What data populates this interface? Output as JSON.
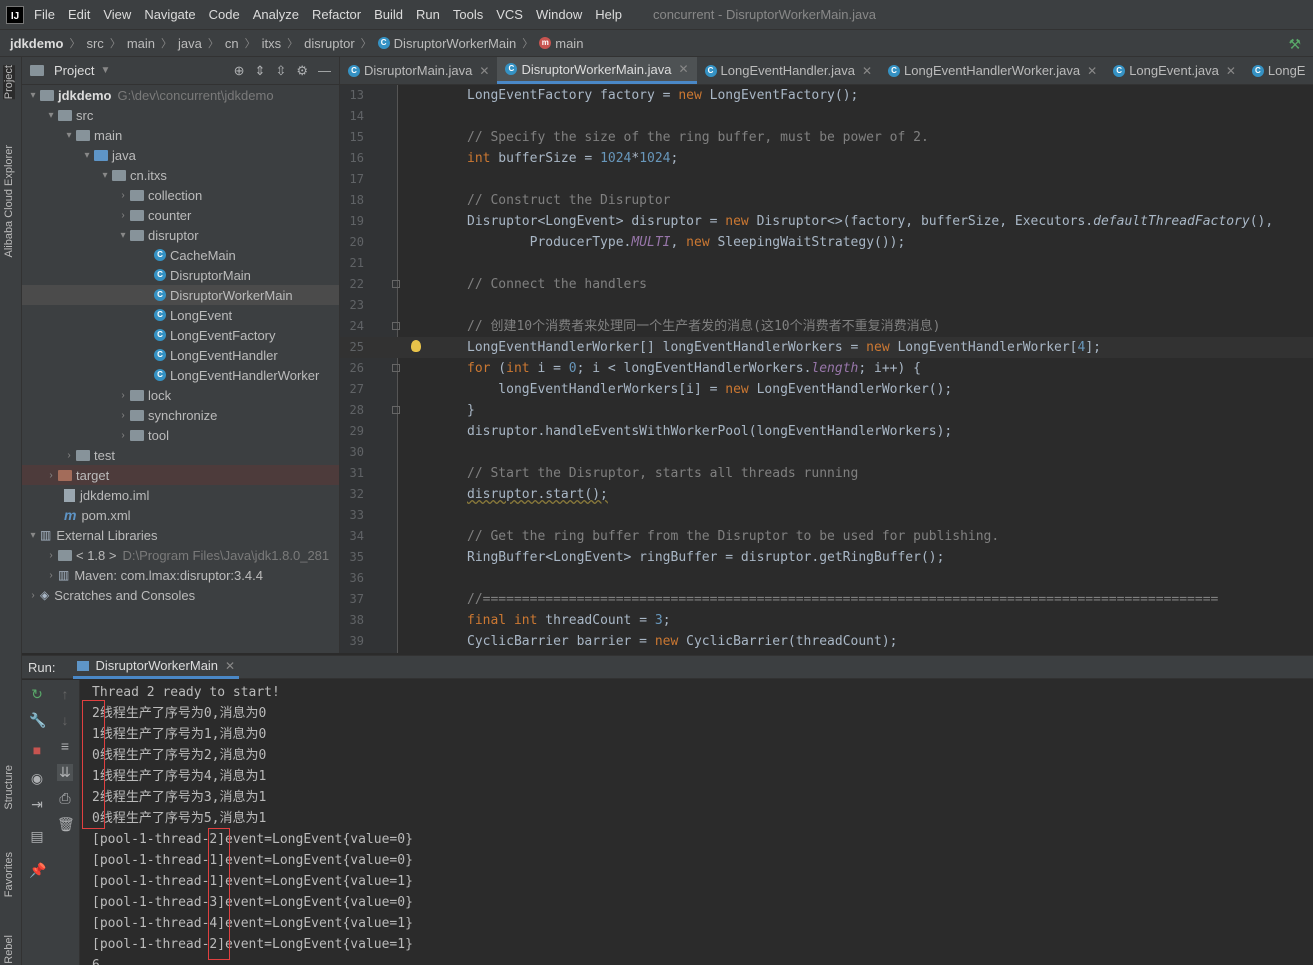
{
  "menubar": {
    "logo": "IJ",
    "items": [
      "File",
      "Edit",
      "View",
      "Navigate",
      "Code",
      "Analyze",
      "Refactor",
      "Build",
      "Run",
      "Tools",
      "VCS",
      "Window",
      "Help"
    ],
    "window_title": "concurrent - DisruptorWorkerMain.java"
  },
  "breadcrumb": {
    "items": [
      "jdkdemo",
      "src",
      "main",
      "java",
      "cn",
      "itxs",
      "disruptor",
      "DisruptorWorkerMain",
      "main"
    ]
  },
  "left_strip": {
    "project": "Project",
    "alibaba": "Alibaba Cloud Explorer",
    "structure": "Structure",
    "favorites": "Favorites",
    "rebel": "Rebel"
  },
  "project_panel": {
    "title": "Project",
    "tree": [
      {
        "label": "jdkdemo",
        "extra": "G:\\dev\\concurrent\\jdkdemo"
      },
      {
        "label": "src"
      },
      {
        "label": "main"
      },
      {
        "label": "java"
      },
      {
        "label": "cn.itxs"
      },
      {
        "label": "collection"
      },
      {
        "label": "counter"
      },
      {
        "label": "disruptor"
      },
      {
        "label": "CacheMain"
      },
      {
        "label": "DisruptorMain"
      },
      {
        "label": "DisruptorWorkerMain"
      },
      {
        "label": "LongEvent"
      },
      {
        "label": "LongEventFactory"
      },
      {
        "label": "LongEventHandler"
      },
      {
        "label": "LongEventHandlerWorker"
      },
      {
        "label": "lock"
      },
      {
        "label": "synchronize"
      },
      {
        "label": "tool"
      },
      {
        "label": "test"
      },
      {
        "label": "target"
      },
      {
        "label": "jdkdemo.iml"
      },
      {
        "label": "pom.xml"
      },
      {
        "label": "External Libraries"
      },
      {
        "label": "< 1.8 >",
        "extra": "D:\\Program Files\\Java\\jdk1.8.0_281"
      },
      {
        "label": "Maven: com.lmax:disruptor:3.4.4"
      },
      {
        "label": "Scratches and Consoles"
      }
    ]
  },
  "editor_tabs": [
    "DisruptorMain.java",
    "DisruptorWorkerMain.java",
    "LongEventHandler.java",
    "LongEventHandlerWorker.java",
    "LongEvent.java",
    "LongE"
  ],
  "editor": {
    "line_numbers": [
      "13",
      "14",
      "15",
      "16",
      "17",
      "18",
      "19",
      "20",
      "21",
      "22",
      "23",
      "24",
      "25",
      "26",
      "27",
      "28",
      "29",
      "30",
      "31",
      "32",
      "33",
      "34",
      "35",
      "36",
      "37",
      "38",
      "39"
    ],
    "lines": {
      "l13": "LongEventFactory factory = ",
      "l13b": "new",
      "l13c": " LongEventFactory();",
      "l15": "// Specify the size of the ring buffer, must be power of 2.",
      "l16a": "int",
      "l16b": " bufferSize = ",
      "l16c": "1024",
      "l16d": "*",
      "l16e": "1024",
      "l16f": ";",
      "l18": "// Construct the Disruptor",
      "l19a": "Disruptor<LongEvent> disruptor = ",
      "l19b": "new",
      "l19c": " Disruptor<>(factory, bufferSize, Executors.",
      "l19d": "defaultThreadFactory",
      "l19e": "(),",
      "l20a": "        ProducerType.",
      "l20b": "MULTI",
      "l20c": ", ",
      "l20d": "new",
      "l20e": " SleepingWaitStrategy());",
      "l22": "// Connect the handlers",
      "l24": "// 创建10个消费者来处理同一个生产者发的消息(这10个消费者不重复消费消息)",
      "l25a": "LongEventHandlerWorker[] longEventHandlerWorkers = ",
      "l25b": "new",
      "l25c": " LongEventHandlerWorker[",
      "l25d": "4",
      "l25e": "];",
      "l26a": "for",
      "l26b": " (",
      "l26c": "int",
      "l26d": " i = ",
      "l26e": "0",
      "l26f": "; i < longEventHandlerWorkers.",
      "l26g": "length",
      "l26h": "; i++) {",
      "l27a": "    longEventHandlerWorkers[i] = ",
      "l27b": "new",
      "l27c": " LongEventHandlerWorker();",
      "l28": "}",
      "l29": "disruptor.handleEventsWithWorkerPool(longEventHandlerWorkers);",
      "l31": "// Start the Disruptor, starts all threads running",
      "l32": "disruptor.start();",
      "l34": "// Get the ring buffer from the Disruptor to be used for publishing.",
      "l35": "RingBuffer<LongEvent> ringBuffer = disruptor.getRingBuffer();",
      "l37": "//==============================================================================================",
      "l38a": "final",
      "l38b": " ",
      "l38c": "int",
      "l38d": " threadCount = ",
      "l38e": "3",
      "l38f": ";",
      "l39a": "CyclicBarrier barrier = ",
      "l39b": "new",
      "l39c": " CyclicBarrier(threadCount);"
    }
  },
  "run_panel": {
    "label": "Run:",
    "tab": "DisruptorWorkerMain",
    "console": [
      "Thread 2 ready to start!",
      "2线程生产了序号为0,消息为0",
      "1线程生产了序号为1,消息为0",
      "0线程生产了序号为2,消息为0",
      "1线程生产了序号为4,消息为1",
      "2线程生产了序号为3,消息为1",
      "0线程生产了序号为5,消息为1",
      "[pool-1-thread-2]event=LongEvent{value=0}",
      "[pool-1-thread-1]event=LongEvent{value=0}",
      "[pool-1-thread-1]event=LongEvent{value=1}",
      "[pool-1-thread-3]event=LongEvent{value=0}",
      "[pool-1-thread-4]event=LongEvent{value=1}",
      "[pool-1-thread-2]event=LongEvent{value=1}",
      "6"
    ]
  },
  "colors": {
    "accent": "#4a88c7",
    "highlight_box": "#e04040",
    "keyword": "#cc7832",
    "number": "#6897bb",
    "comment": "#808080"
  }
}
